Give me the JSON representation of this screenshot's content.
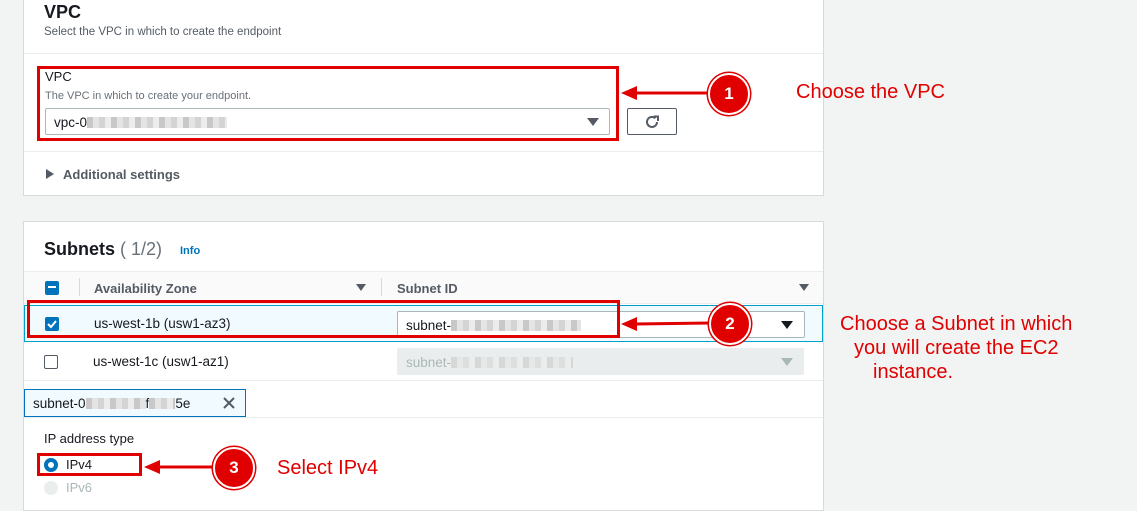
{
  "vpc_section": {
    "title": "VPC",
    "description": "Select the VPC in which to create the endpoint",
    "field_label": "VPC",
    "field_description": "The VPC in which to create your endpoint.",
    "selected_value": "vpc-0",
    "additional_settings": "Additional settings"
  },
  "subnets_section": {
    "title": "Subnets",
    "count": "( 1/2)",
    "info_link": "Info",
    "columns": [
      "Availability Zone",
      "Subnet ID"
    ],
    "rows": [
      {
        "zone": "us-west-1b (usw1-az3)",
        "subnet": "subnet-",
        "checked": true
      },
      {
        "zone": "us-west-1c (usw1-az1)",
        "subnet": "subnet-",
        "checked": false
      }
    ],
    "selected_token": {
      "prefix": "subnet-0",
      "middle": "f",
      "suffix": "5e"
    }
  },
  "ip_type": {
    "label": "IP address type",
    "options": [
      {
        "label": "IPv4",
        "selected": true,
        "disabled": false
      },
      {
        "label": "IPv6",
        "selected": false,
        "disabled": true
      }
    ]
  },
  "annotations": [
    {
      "number": "1",
      "text": "Choose the VPC"
    },
    {
      "number": "2",
      "lines": [
        "Choose a Subnet in which",
        "you will create the EC2",
        "instance."
      ]
    },
    {
      "number": "3",
      "text": "Select IPv4"
    }
  ],
  "colors": {
    "accent": "#0073bb",
    "annotation_red": "#e00000",
    "checkbox_blue": "#0073bb"
  },
  "icons": [
    "refresh-icon",
    "caret-right-icon",
    "caret-down-icon",
    "close-icon",
    "arrow-left-icon"
  ]
}
